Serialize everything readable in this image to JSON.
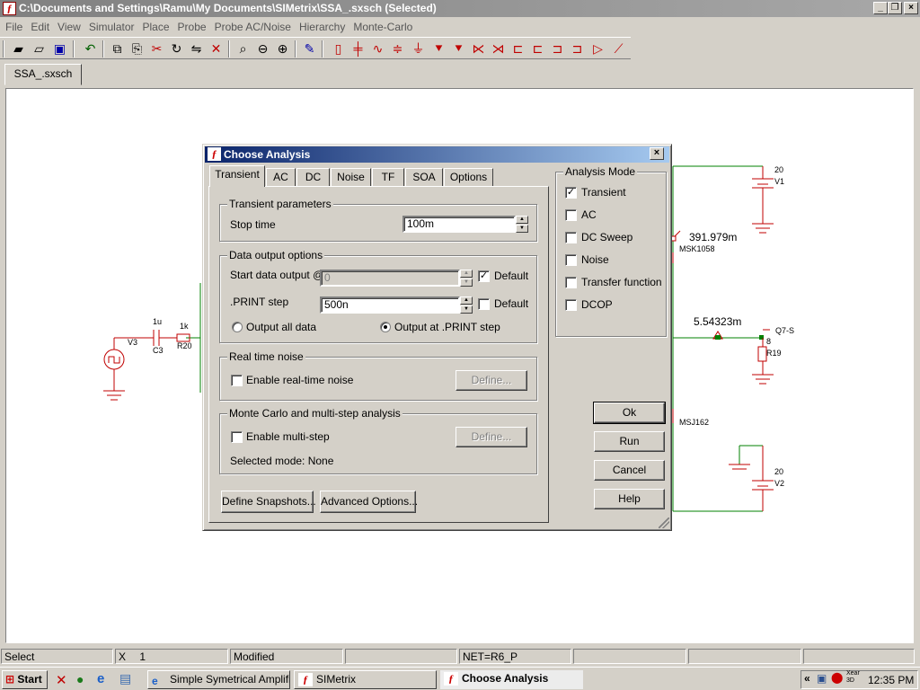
{
  "window": {
    "title": "C:\\Documents and Settings\\Ramu\\My Documents\\SIMetrix\\SSA_.sxsch (Selected)"
  },
  "menu": [
    "File",
    "Edit",
    "View",
    "Simulator",
    "Place",
    "Probe",
    "Probe AC/Noise",
    "Hierarchy",
    "Monte-Carlo"
  ],
  "document_tab": "SSA_.sxsch",
  "schematic": {
    "labels": {
      "v1_value": "20",
      "v1_name": "V1",
      "probe1": "391.979m",
      "msk": "MSK1058",
      "probe2": "5.54323m",
      "q7": "Q7-S",
      "r19_val": "8",
      "r19": "R19",
      "msj": "MSJ162",
      "v2_value": "20",
      "v2_name": "V2",
      "v3": "V3",
      "c3_val": "1u",
      "c3": "C3",
      "r20_val": "1k",
      "r20": "R20"
    }
  },
  "dialog": {
    "title": "Choose Analysis",
    "tabs": [
      "Transient",
      "AC",
      "DC",
      "Noise",
      "TF",
      "SOA",
      "Options"
    ],
    "active_tab": "Transient",
    "transient_params": {
      "legend": "Transient parameters",
      "stop_time_label": "Stop time",
      "stop_time_value": "100m"
    },
    "data_output": {
      "legend": "Data output options",
      "start_label": "Start data output @",
      "start_value": "0",
      "start_default_label": "Default",
      "start_default_checked": true,
      "print_label": ".PRINT step",
      "print_value": "500n",
      "print_default_label": "Default",
      "print_default_checked": false,
      "radio_all_label": "Output all data",
      "radio_print_label": "Output at .PRINT step",
      "radio_selected": "print"
    },
    "real_time_noise": {
      "legend": "Real time noise",
      "enable_label": "Enable real-time noise",
      "checked": false,
      "define_label": "Define..."
    },
    "monte_carlo": {
      "legend": "Monte Carlo and multi-step analysis",
      "enable_label": "Enable multi-step",
      "checked": false,
      "define_label": "Define...",
      "selected_mode_text": "Selected mode: None"
    },
    "define_snapshots_label": "Define Snapshots...",
    "advanced_options_label": "Advanced Options...",
    "analysis_mode": {
      "legend": "Analysis Mode",
      "options": [
        {
          "label": "Transient",
          "checked": true
        },
        {
          "label": "AC",
          "checked": false
        },
        {
          "label": "DC Sweep",
          "checked": false
        },
        {
          "label": "Noise",
          "checked": false
        },
        {
          "label": "Transfer function",
          "checked": false
        },
        {
          "label": "DCOP",
          "checked": false
        }
      ]
    },
    "buttons": {
      "ok": "Ok",
      "run": "Run",
      "cancel": "Cancel",
      "help": "Help"
    }
  },
  "statusbar": {
    "mode": "Select",
    "x_label": "X",
    "x_value": "1",
    "modified": "Modified",
    "net": "NET=R6_P"
  },
  "taskbar": {
    "start": "Start",
    "tasks": [
      "Simple Symetrical Amplifi...",
      "SIMetrix",
      "Choose Analysis"
    ],
    "active_task": "Choose Analysis",
    "clock": "12:35 PM",
    "tray_xear": "Xear 3D"
  },
  "colors": {
    "title_gradient_start": "#0a246a",
    "schematic_wire": "#008000",
    "schematic_component": "#c00000"
  }
}
